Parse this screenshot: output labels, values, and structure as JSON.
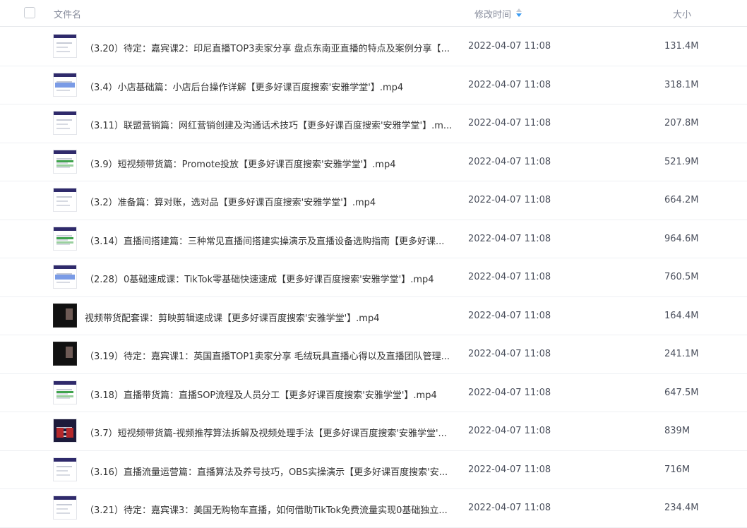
{
  "header": {
    "name_label": "文件名",
    "time_label": "修改时间",
    "size_label": "大小",
    "sort_icon": "sort-desc-icon",
    "sort_color": "#3b9cf2"
  },
  "files": [
    {
      "name": "（3.20）待定：嘉宾课2：印尼直播TOP3卖家分享 盘点东南亚直播的特点及案例分享【...",
      "time": "2022-04-07 11:08",
      "size": "131.4M",
      "thumb": "doc"
    },
    {
      "name": "（3.4）小店基础篇：小店后台操作详解【更多好课百度搜索'安雅学堂'】.mp4",
      "time": "2022-04-07 11:08",
      "size": "318.1M",
      "thumb": "blue"
    },
    {
      "name": "（3.11）联盟营销篇：网红营销创建及沟通话术技巧【更多好课百度搜索'安雅学堂'】.m...",
      "time": "2022-04-07 11:08",
      "size": "207.8M",
      "thumb": "doc"
    },
    {
      "name": "（3.9）短视频带货篇：Promote投放【更多好课百度搜索'安雅学堂'】.mp4",
      "time": "2022-04-07 11:08",
      "size": "521.9M",
      "thumb": "green"
    },
    {
      "name": "（3.2）准备篇：算对账，选对品【更多好课百度搜索'安雅学堂'】.mp4",
      "time": "2022-04-07 11:08",
      "size": "664.2M",
      "thumb": "doc"
    },
    {
      "name": "（3.14）直播间搭建篇：三种常见直播间搭建实操演示及直播设备选购指南【更多好课...",
      "time": "2022-04-07 11:08",
      "size": "964.6M",
      "thumb": "green"
    },
    {
      "name": "（2.28）0基础速成课：TikTok零基础快速速成【更多好课百度搜索'安雅学堂'】.mp4",
      "time": "2022-04-07 11:08",
      "size": "760.5M",
      "thumb": "blue"
    },
    {
      "name": "视频带货配套课：剪映剪辑速成课【更多好课百度搜索'安雅学堂'】.mp4",
      "time": "2022-04-07 11:08",
      "size": "164.4M",
      "thumb": "dark"
    },
    {
      "name": "（3.19）待定：嘉宾课1：英国直播TOP1卖家分享 毛绒玩具直播心得以及直播团队管理...",
      "time": "2022-04-07 11:08",
      "size": "241.1M",
      "thumb": "dark"
    },
    {
      "name": "（3.18）直播带货篇：直播SOP流程及人员分工【更多好课百度搜索'安雅学堂'】.mp4",
      "time": "2022-04-07 11:08",
      "size": "647.5M",
      "thumb": "green"
    },
    {
      "name": "（3.7）短视频带货篇-视频推荐算法拆解及视频处理手法【更多好课百度搜索'安雅学堂'...",
      "time": "2022-04-07 11:08",
      "size": "839M",
      "thumb": "red"
    },
    {
      "name": "（3.16）直播流量运营篇：直播算法及养号技巧，OBS实操演示【更多好课百度搜索'安...",
      "time": "2022-04-07 11:08",
      "size": "716M",
      "thumb": "doc"
    },
    {
      "name": "（3.21）待定：嘉宾课3：美国无购物车直播，如何借助TikTok免费流量实现0基础独立...",
      "time": "2022-04-07 11:08",
      "size": "234.4M",
      "thumb": "doc"
    }
  ]
}
